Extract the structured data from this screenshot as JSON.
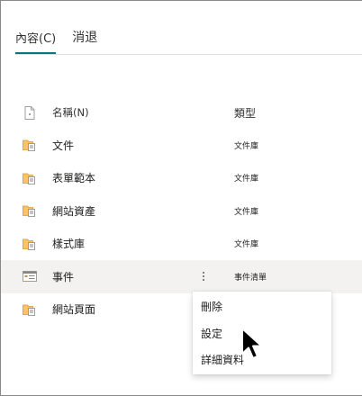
{
  "tabs": {
    "content_label": "內容(C)",
    "cancel_label": "消退"
  },
  "list": {
    "header": {
      "name": "名稱(N)",
      "type": "類型"
    },
    "rows": [
      {
        "name": "文件",
        "type": "文件庫",
        "icon": "library-icon"
      },
      {
        "name": "表單範本",
        "type": "文件庫",
        "icon": "library-icon"
      },
      {
        "name": "網站資產",
        "type": "文件庫",
        "icon": "library-icon"
      },
      {
        "name": "樣式庫",
        "type": "文件庫",
        "icon": "library-icon"
      },
      {
        "name": "事件",
        "type": "事件清單",
        "icon": "calendar-list-icon",
        "selected": true
      },
      {
        "name": "網站頁面",
        "type": "",
        "icon": "library-icon"
      }
    ]
  },
  "context_menu": {
    "items": [
      "刪除",
      "設定",
      "詳細資料"
    ]
  },
  "colors": {
    "tab_underline": "#03787c",
    "library_icon": "#f2a33a",
    "selected_row": "#f3f2f1"
  }
}
